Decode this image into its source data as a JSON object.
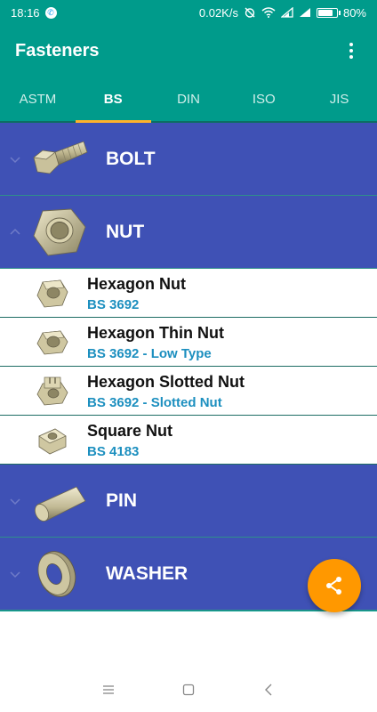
{
  "status_bar": {
    "time": "18:16",
    "network_speed": "0.02K/s",
    "battery": "80%",
    "battery_level": 0.8
  },
  "app_bar": {
    "title": "Fasteners",
    "overflow_icon": "more-vert-icon"
  },
  "tabs": [
    {
      "label": "ASTM",
      "active": false
    },
    {
      "label": "BS",
      "active": true
    },
    {
      "label": "DIN",
      "active": false
    },
    {
      "label": "ISO",
      "active": false
    },
    {
      "label": "JIS",
      "active": false
    }
  ],
  "groups": {
    "bolt": {
      "label": "BOLT",
      "expanded": false,
      "icon": "bolt-icon"
    },
    "nut": {
      "label": "NUT",
      "expanded": true,
      "icon": "hex-nut-icon"
    },
    "pin": {
      "label": "PIN",
      "expanded": false,
      "icon": "pin-icon"
    },
    "washer": {
      "label": "WASHER",
      "expanded": false,
      "icon": "washer-icon"
    }
  },
  "nut_items": [
    {
      "title": "Hexagon Nut",
      "standard": "BS 3692"
    },
    {
      "title": "Hexagon Thin Nut",
      "standard": "BS 3692 - Low Type"
    },
    {
      "title": "Hexagon Slotted Nut",
      "standard": "BS 3692 - Slotted Nut"
    },
    {
      "title": "Square Nut",
      "standard": "BS 4183"
    }
  ],
  "fab": {
    "icon": "share-icon"
  },
  "colors": {
    "primary": "#009b8b",
    "group_bg": "#3f51b5",
    "accent": "#ff9800",
    "tab_indicator": "#ffb22b",
    "subtitle": "#1c8fbf"
  }
}
